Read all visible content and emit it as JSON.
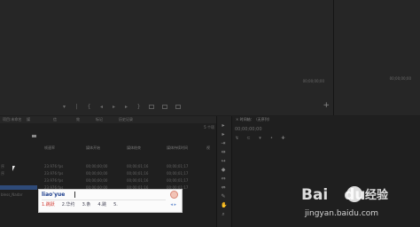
{
  "source_monitor": {
    "timecode": "00;00;00;00",
    "transport_icons": [
      "mark-in-icon",
      "mark-out-icon",
      "go-to-in-icon",
      "step-back-icon",
      "play-icon",
      "step-forward-icon",
      "go-to-out-icon",
      "insert-icon",
      "overwrite-icon",
      "export-frame-icon"
    ],
    "add_button": "+"
  },
  "program_monitor": {
    "timecode": "00;00;00;00"
  },
  "project_panel": {
    "tabs": [
      "项目:未命名",
      "媒",
      "信",
      "效",
      "标记",
      "历史记录"
    ],
    "item_count": "5 个项",
    "columns": [
      "帧速率",
      "媒体开始",
      "媒体结束",
      "媒体持续时间",
      "视"
    ],
    "rows": [
      [
        "23.976 fps",
        "00;00;00;00",
        "00;00;01;16",
        "00;00;01;17"
      ],
      [
        "23.976 fps",
        "00;00;00;00",
        "00;00;01;16",
        "00;00;01;17"
      ],
      [
        "23.976 fps",
        "00;00;00;00",
        "00;00;01;16",
        "00;00;01;17"
      ],
      [
        "23.976 fps",
        "00;00;00;00",
        "00;00;01;16",
        "00;00;01;17"
      ]
    ],
    "row_labels": [
      "序",
      "序",
      "",
      "bless_Nadar"
    ]
  },
  "ime": {
    "pinyin": "liao'yue",
    "candidates": [
      "1.跳跃",
      "2.华约",
      "3.条",
      "4.跳",
      "5."
    ]
  },
  "timeline_panel": {
    "tab_label": "× 时间轴：（无序列）",
    "timecode": "00;00;00;00",
    "tool_icons": [
      "snap-icon",
      "linked-selection-icon",
      "add-marker-icon",
      "settings-icon",
      "wrench-icon"
    ]
  },
  "tools": [
    "selection-tool-icon",
    "track-select-tool-icon",
    "ripple-edit-tool-icon",
    "rolling-edit-tool-icon",
    "rate-stretch-tool-icon",
    "razor-tool-icon",
    "slip-tool-icon",
    "slide-tool-icon",
    "pen-tool-icon",
    "hand-tool-icon",
    "zoom-tool-icon"
  ],
  "watermark": {
    "logo": "Bai",
    "logo_tail": "du",
    "text": "经验",
    "url": "jingyan.baidu.com"
  }
}
